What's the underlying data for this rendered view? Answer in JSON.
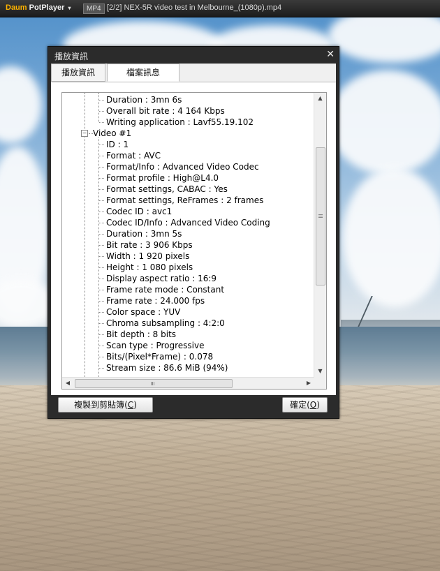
{
  "app": {
    "logo_brand": "Daum",
    "logo_name": "PotPlayer",
    "menu_caret": "▾",
    "format_badge": "MP4",
    "file_title": "[2/2] NEX-5R video test in Melbourne_(1080p).mp4"
  },
  "dialog": {
    "title": "播放資訊",
    "close_glyph": "✕",
    "tabs": [
      {
        "label": "播放資訊",
        "selected": false
      },
      {
        "label": "檔案訊息",
        "selected": true
      }
    ],
    "tree": {
      "general_items": [
        "Duration : 3mn 6s",
        "Overall bit rate : 4 164 Kbps",
        "Writing application : Lavf55.19.102"
      ],
      "video_node": {
        "label": "Video #1",
        "expander": "−",
        "items": [
          "ID : 1",
          "Format : AVC",
          "Format/Info : Advanced Video Codec",
          "Format profile : High@L4.0",
          "Format settings, CABAC : Yes",
          "Format settings, ReFrames : 2 frames",
          "Codec ID : avc1",
          "Codec ID/Info : Advanced Video Coding",
          "Duration : 3mn 5s",
          "Bit rate : 3 906 Kbps",
          "Width : 1 920 pixels",
          "Height : 1 080 pixels",
          "Display aspect ratio : 16:9",
          "Frame rate mode : Constant",
          "Frame rate : 24.000 fps",
          "Color space : YUV",
          "Chroma subsampling : 4:2:0",
          "Bit depth : 8 bits",
          "Scan type : Progressive",
          "Bits/(Pixel*Frame) : 0.078",
          "Stream size : 86.6 MiB (94%)"
        ]
      }
    },
    "scrollbar": {
      "up": "▲",
      "down": "▼",
      "left": "◀",
      "right": "▶"
    },
    "buttons": {
      "copy_label": "複製到剪貼簿(",
      "copy_hotkey": "C",
      "ok_label": "確定(",
      "ok_hotkey": "O",
      "close_paren": ")"
    }
  },
  "colors": {
    "titlebar": "#1c1c1c",
    "dialog_frame": "#2b2b2b",
    "panel": "#ffffff"
  }
}
